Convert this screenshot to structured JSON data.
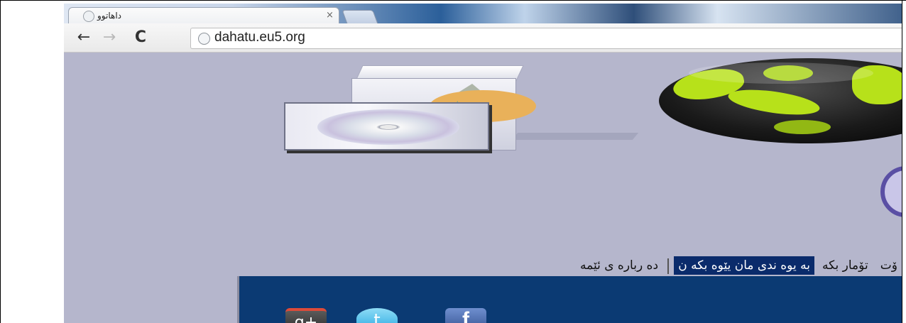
{
  "tab": {
    "title": "داهاتوو",
    "close": "×"
  },
  "toolbar": {
    "back": "←",
    "forward": "→",
    "reload": "C",
    "url": "dahatu.eu5.org"
  },
  "menu": {
    "items": [
      {
        "label": "ده رباره ی ئێمه",
        "active": false
      },
      {
        "label": "به یوه ندی مان یێوه بکه ن",
        "active": true
      },
      {
        "label": "تۆمار بکه",
        "active": false
      },
      {
        "label": "ۆت",
        "active": false
      }
    ]
  },
  "social": {
    "gplus": "g+",
    "twitter": "t",
    "facebook": "f"
  },
  "colors": {
    "page_bg": "#b5b6cc",
    "active_menu": "#0a2b6b",
    "panel": "#0b3a73"
  }
}
